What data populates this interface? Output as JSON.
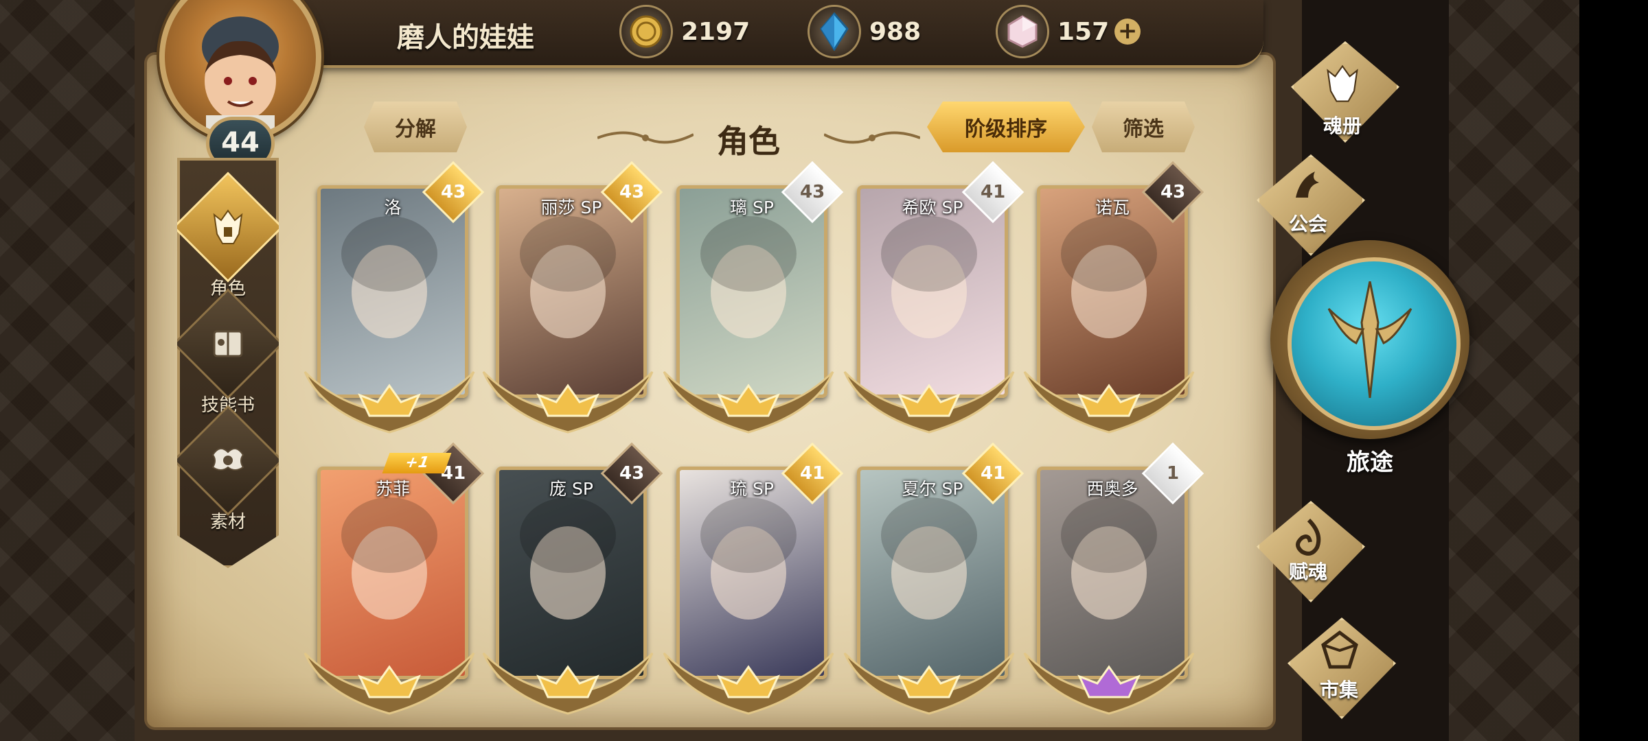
{
  "player": {
    "name": "磨人的娃娃",
    "level": "44"
  },
  "currencies": [
    {
      "name": "gold-coin-icon",
      "value": "2197"
    },
    {
      "name": "blue-crystal-icon",
      "value": "988"
    },
    {
      "name": "pink-gem-icon",
      "value": "157"
    }
  ],
  "currency_add": "+",
  "side_nav": [
    {
      "label": "角色",
      "icon": "helmet-icon",
      "active": true
    },
    {
      "label": "技能书",
      "icon": "skill-book-icon",
      "active": false
    },
    {
      "label": "素材",
      "icon": "material-icon",
      "active": false
    }
  ],
  "toolbar": {
    "decompose": "分解",
    "title": "角色",
    "sort": "阶级排序",
    "filter": "筛选"
  },
  "characters": [
    {
      "name": "洛",
      "level": "43",
      "badge": "gold"
    },
    {
      "name": "丽莎 SP",
      "level": "43",
      "badge": "gold"
    },
    {
      "name": "璃 SP",
      "level": "43",
      "badge": "white"
    },
    {
      "name": "希欧 SP",
      "level": "41",
      "badge": "white"
    },
    {
      "name": "诺瓦",
      "level": "43",
      "badge": "dark"
    },
    {
      "name": "苏菲",
      "level": "41",
      "badge": "dark",
      "plus": "+1"
    },
    {
      "name": "庞 SP",
      "level": "43",
      "badge": "dark"
    },
    {
      "name": "琉 SP",
      "level": "41",
      "badge": "gold"
    },
    {
      "name": "夏尔 SP",
      "level": "41",
      "badge": "gold"
    },
    {
      "name": "西奥多",
      "level": "1",
      "badge": "white"
    }
  ],
  "right_menu": {
    "soul_book": "魂册",
    "guild": "公会",
    "journey": "旅途",
    "soul_gift": "赋魂",
    "market": "市集"
  },
  "colors": {
    "accent_gold": "#e3b04b",
    "journey_teal": "#2fb0c8",
    "paper": "#e8d9b6"
  }
}
